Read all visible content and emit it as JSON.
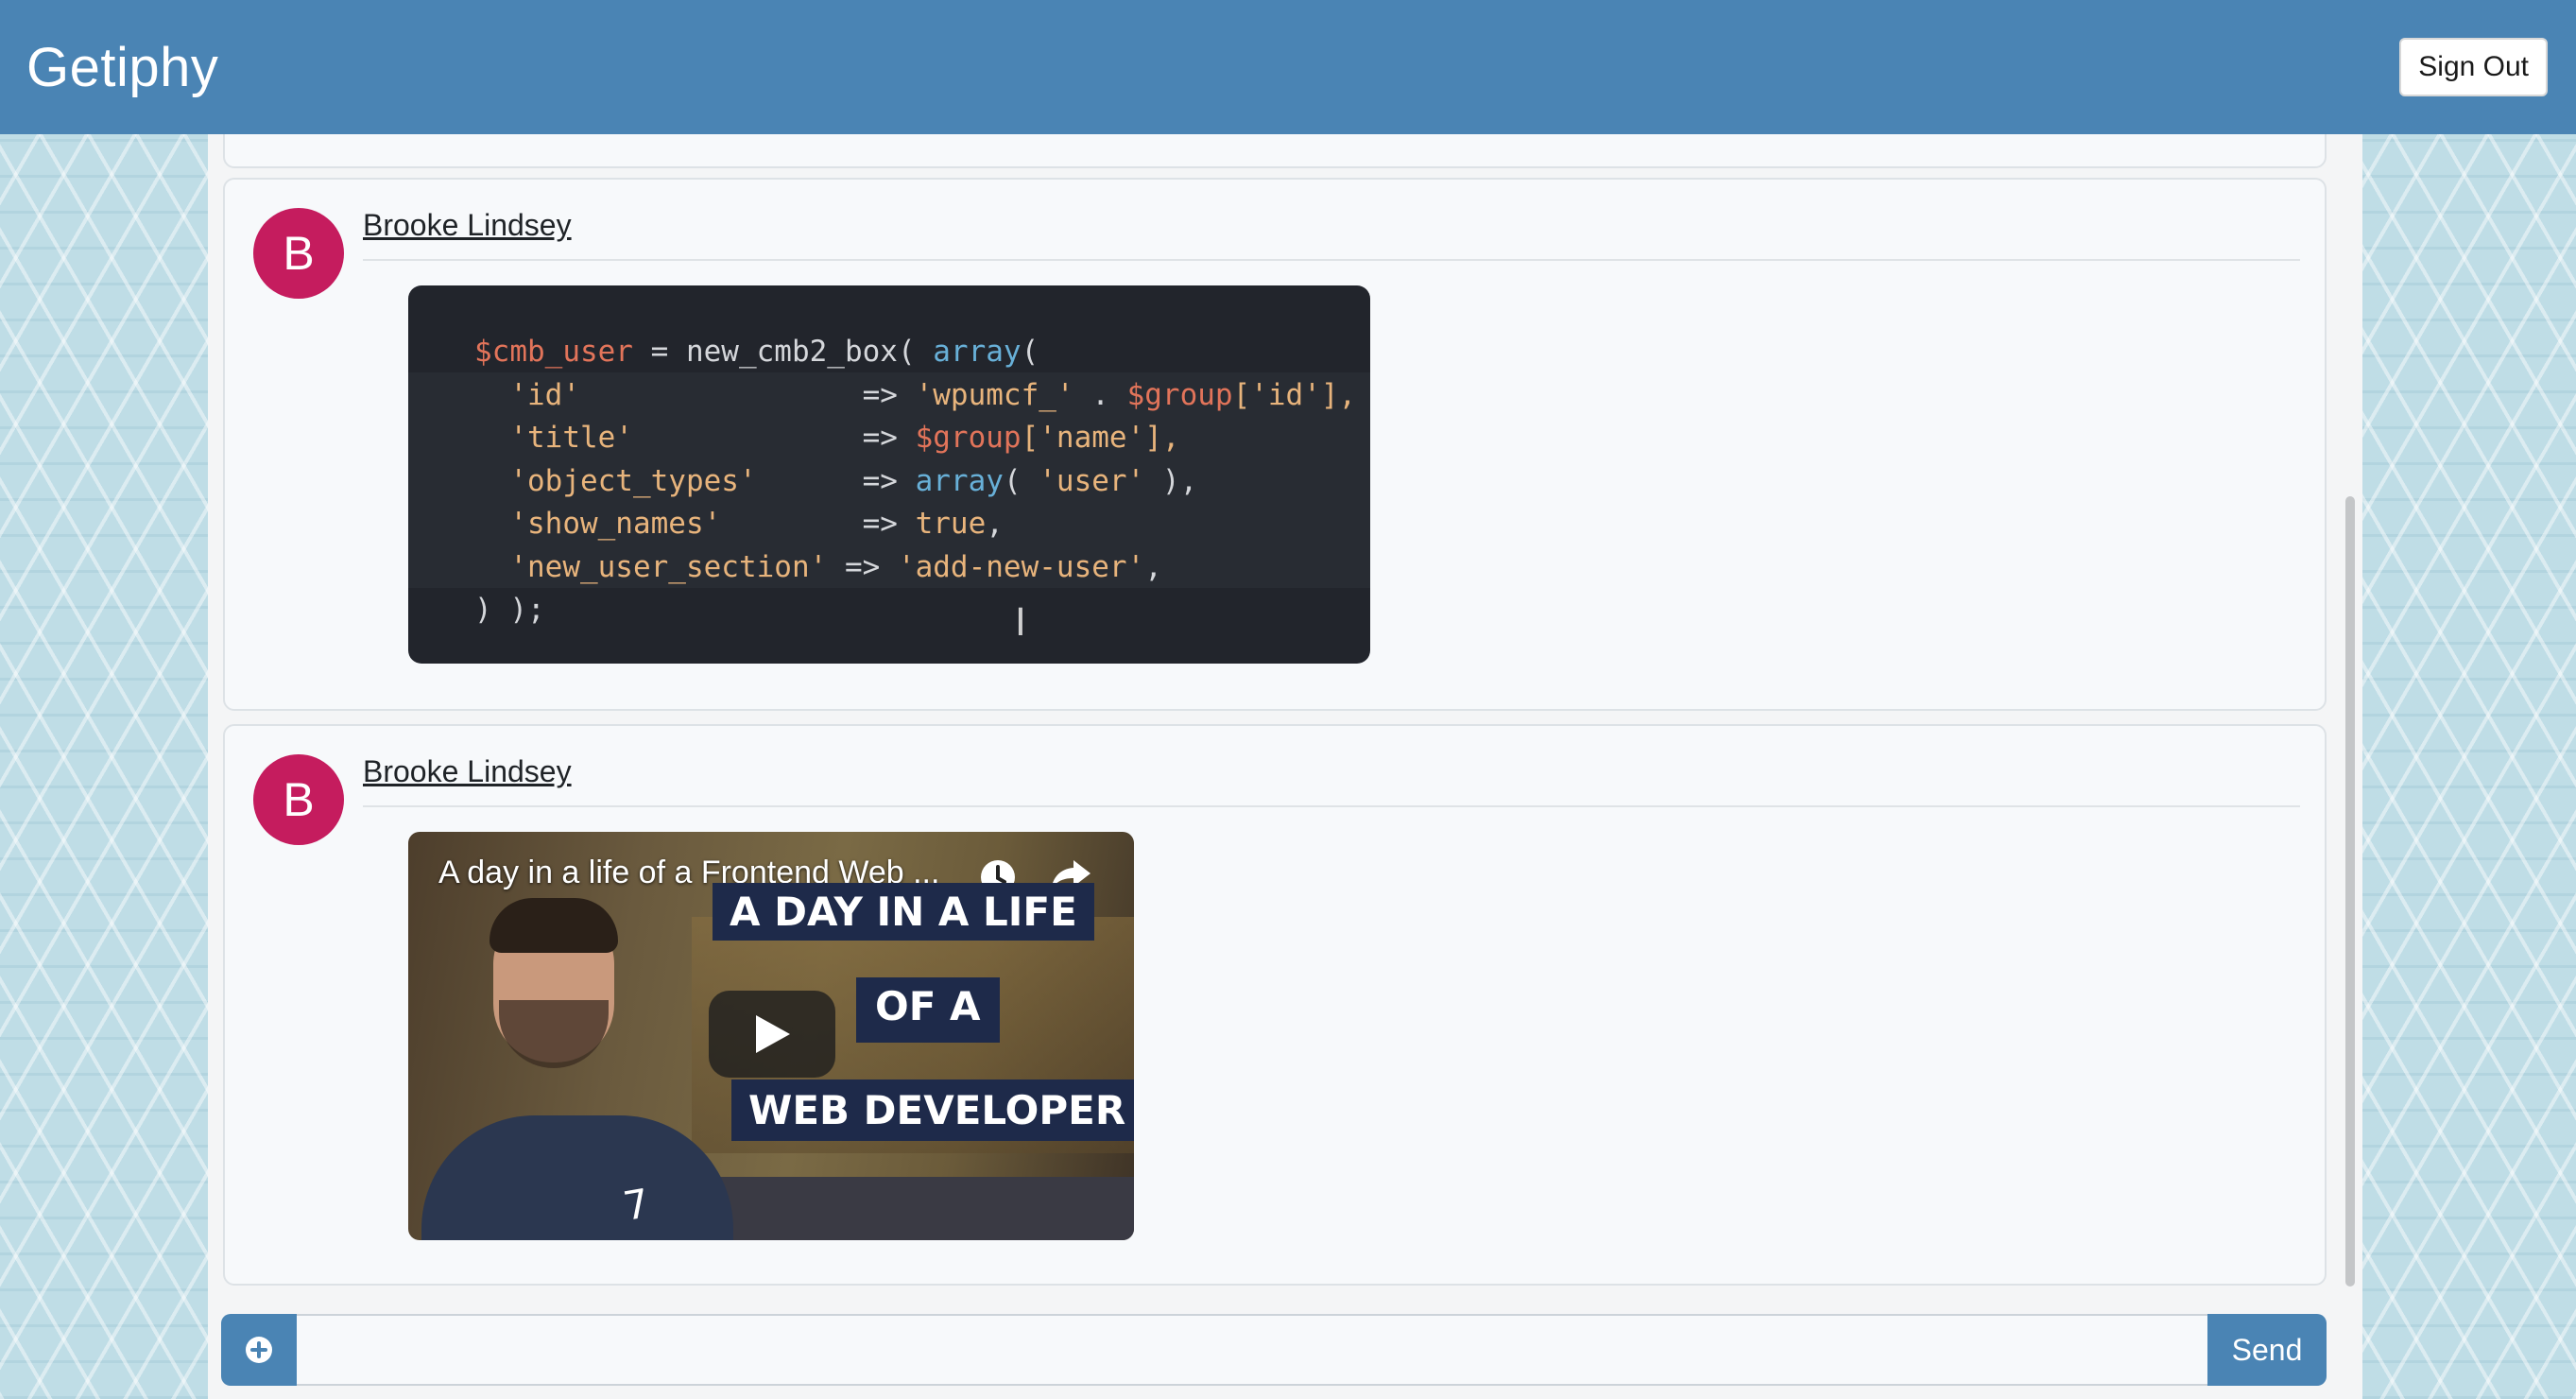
{
  "app": {
    "brand": "Getiphy"
  },
  "header": {
    "signout_label": "Sign Out"
  },
  "messages": [
    {
      "avatar_letter": "B",
      "author": "Brooke Lindsey",
      "media": "code-gif",
      "code_lines": [
        [
          "$cmb_user",
          " = new_cmb2_box( ",
          "array",
          "("
        ],
        [
          "  'id'",
          "                => ",
          "'wpumcf_'",
          " . ",
          "$group",
          "['id'],"
        ],
        [
          "  'title'",
          "             => ",
          "$group",
          "['name'],"
        ],
        [
          "  'object_types'",
          "      => ",
          "array",
          "( ",
          "'user'",
          " ),"
        ],
        [
          "  'show_names'",
          "        => ",
          "true",
          ","
        ],
        [
          "  'new_user_section'",
          " => ",
          "'add-new-user'",
          ","
        ],
        [
          ") );"
        ]
      ]
    },
    {
      "avatar_letter": "B",
      "author": "Brooke Lindsey",
      "media": "youtube-embed",
      "video_title": "A day in a life of a Frontend Web ...",
      "banner_line1": "A DAY IN A LIFE",
      "banner_line2": "OF A",
      "banner_line3": "WEB DEVELOPER"
    }
  ],
  "composer": {
    "placeholder": "",
    "send_label": "Send"
  },
  "colors": {
    "header": "#4a84b4",
    "avatar": "#c51c5e",
    "button": "#4a84b4",
    "code_bg": "#22252c"
  },
  "icons": {
    "attach": "plus-circle-icon",
    "video_watch_later": "clock-icon",
    "video_share": "share-icon",
    "video_play": "play-icon"
  }
}
